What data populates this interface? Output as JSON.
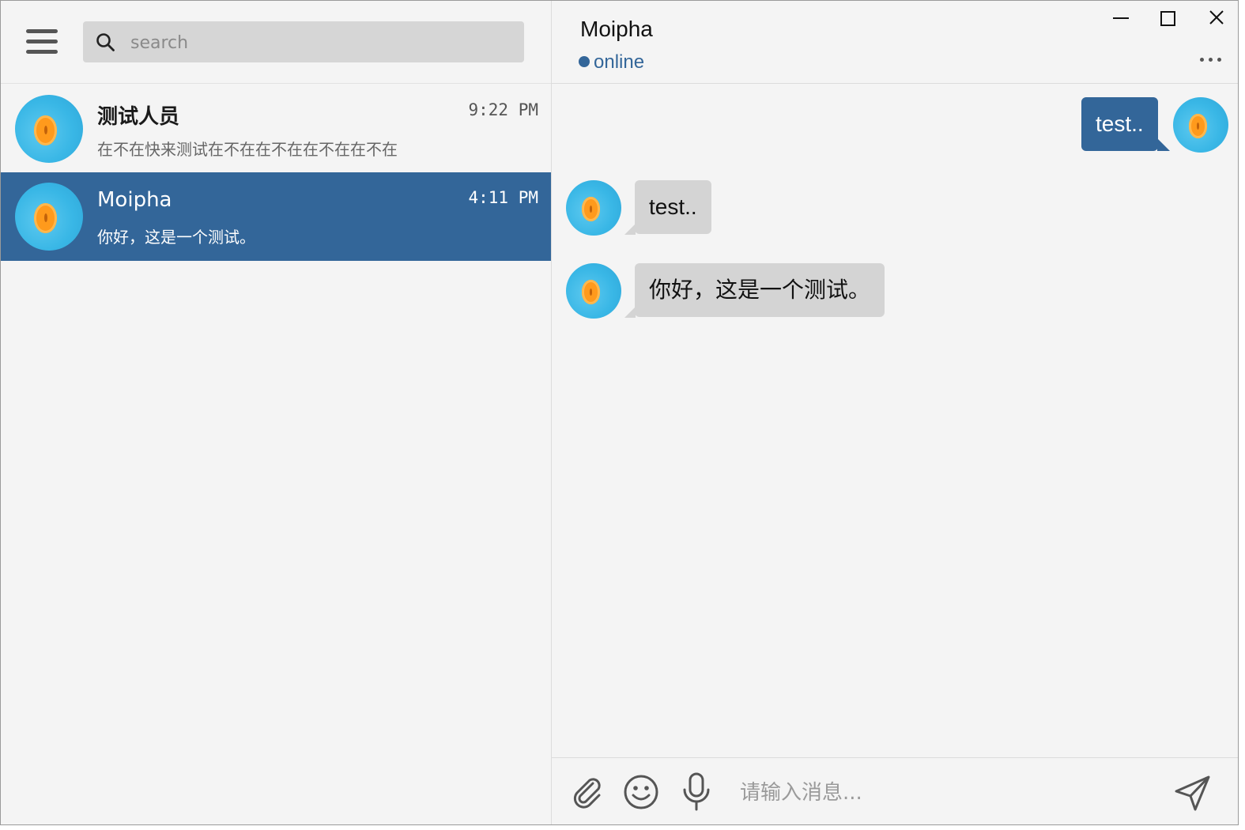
{
  "search": {
    "placeholder": "search"
  },
  "chats": [
    {
      "name": "测试人员",
      "time": "9:22 PM",
      "preview": "在不在快来测试在不在在不在在不在在不在",
      "active": false
    },
    {
      "name": "Moipha",
      "time": "4:11 PM",
      "preview": "你好，这是一个测试。",
      "active": true
    }
  ],
  "header": {
    "contact_name": "Moipha",
    "status": "online"
  },
  "messages": [
    {
      "direction": "out",
      "text": "test.."
    },
    {
      "direction": "in",
      "text": "test.."
    },
    {
      "direction": "in",
      "text": "你好，这是一个测试。"
    }
  ],
  "composer": {
    "placeholder": "请输入消息..."
  },
  "icons": {
    "menu": "hamburger-menu-icon",
    "search": "search-icon",
    "minimize": "minimize-icon",
    "maximize": "maximize-icon",
    "close": "close-icon",
    "more": "more-options-icon",
    "attach": "paperclip-icon",
    "emoji": "smiley-icon",
    "voice": "microphone-icon",
    "send": "send-icon"
  },
  "colors": {
    "accent": "#336699",
    "incoming_bubble": "#d4d4d4",
    "background": "#f4f4f4"
  }
}
